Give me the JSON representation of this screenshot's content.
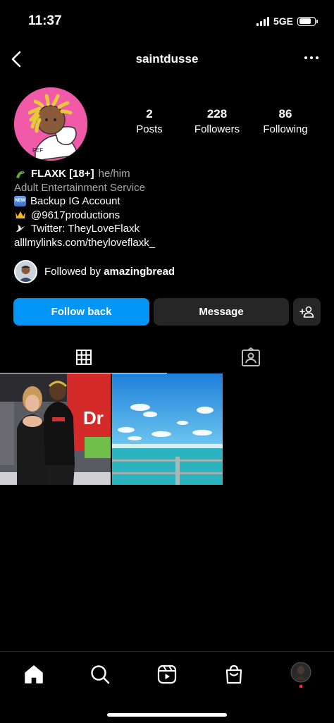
{
  "status_bar": {
    "time": "11:37",
    "network": "5GE",
    "battery_level": 0.8
  },
  "header": {
    "username": "saintdusse",
    "back_icon": "chevron-left-icon",
    "more_icon": "more-horizontal-icon"
  },
  "stats": [
    {
      "value": "2",
      "label": "Posts"
    },
    {
      "value": "228",
      "label": "Followers"
    },
    {
      "value": "86",
      "label": "Following"
    }
  ],
  "bio": {
    "name": "FLAXK [18+]",
    "pronouns": "he/him",
    "category": "Adult Entertainment Service",
    "lines": [
      {
        "icon": "new-badge-icon",
        "text": "Backup IG Account"
      },
      {
        "icon": "crown-icon",
        "text": "@9617productions"
      },
      {
        "icon": "dove-icon",
        "text": "Twitter: TheyLoveFlaxk"
      }
    ],
    "link": "alllmylinks.com/theyloveflaxk_",
    "badge_text": "NEW"
  },
  "followed_by": {
    "prefix": "Followed by ",
    "name": "amazingbread"
  },
  "buttons": {
    "follow_back": "Follow back",
    "message": "Message"
  },
  "tabs": [
    {
      "icon": "grid-icon",
      "active": true
    },
    {
      "icon": "tagged-icon",
      "active": false
    }
  ],
  "bottom_nav": [
    "home-icon",
    "search-icon",
    "reels-icon",
    "shop-icon",
    "profile-avatar"
  ],
  "colors": {
    "accent": "#0095f6",
    "secondary_button": "#262626",
    "muted_text": "#a8a8a8",
    "avatar_bg": "#f05aa8"
  }
}
